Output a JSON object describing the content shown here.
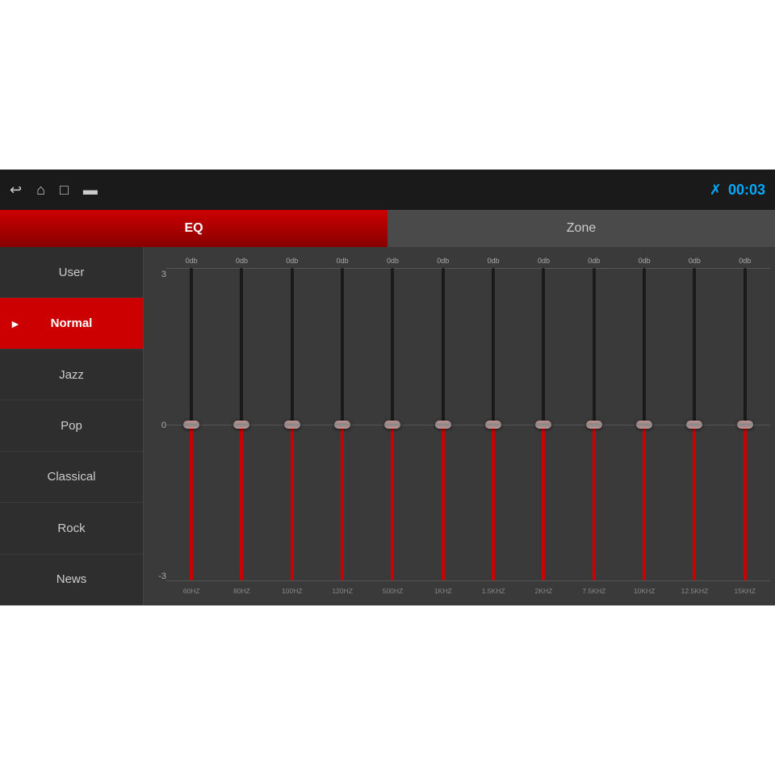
{
  "topbar": {
    "time": "00:03",
    "bluetooth": "bluetooth"
  },
  "tabs": {
    "eq_label": "EQ",
    "zone_label": "Zone"
  },
  "sidebar": {
    "items": [
      {
        "label": "User",
        "active": false
      },
      {
        "label": "Normal",
        "active": true
      },
      {
        "label": "Jazz",
        "active": false
      },
      {
        "label": "Pop",
        "active": false
      },
      {
        "label": "Classical",
        "active": false
      },
      {
        "label": "Rock",
        "active": false
      },
      {
        "label": "News",
        "active": false
      }
    ]
  },
  "eq": {
    "db_top": "3",
    "db_mid": "0",
    "db_bot": "-3",
    "bands": [
      {
        "freq": "60HZ",
        "db": "0db"
      },
      {
        "freq": "80HZ",
        "db": "0db"
      },
      {
        "freq": "100HZ",
        "db": "0db"
      },
      {
        "freq": "120HZ",
        "db": "0db"
      },
      {
        "freq": "500HZ",
        "db": "0db"
      },
      {
        "freq": "1KHZ",
        "db": "0db"
      },
      {
        "freq": "1.5KHZ",
        "db": "0db"
      },
      {
        "freq": "2KHZ",
        "db": "0db"
      },
      {
        "freq": "7.5KHZ",
        "db": "0db"
      },
      {
        "freq": "10KHZ",
        "db": "0db"
      },
      {
        "freq": "12.5KHZ",
        "db": "0db"
      },
      {
        "freq": "15KHZ",
        "db": "0db"
      }
    ]
  }
}
